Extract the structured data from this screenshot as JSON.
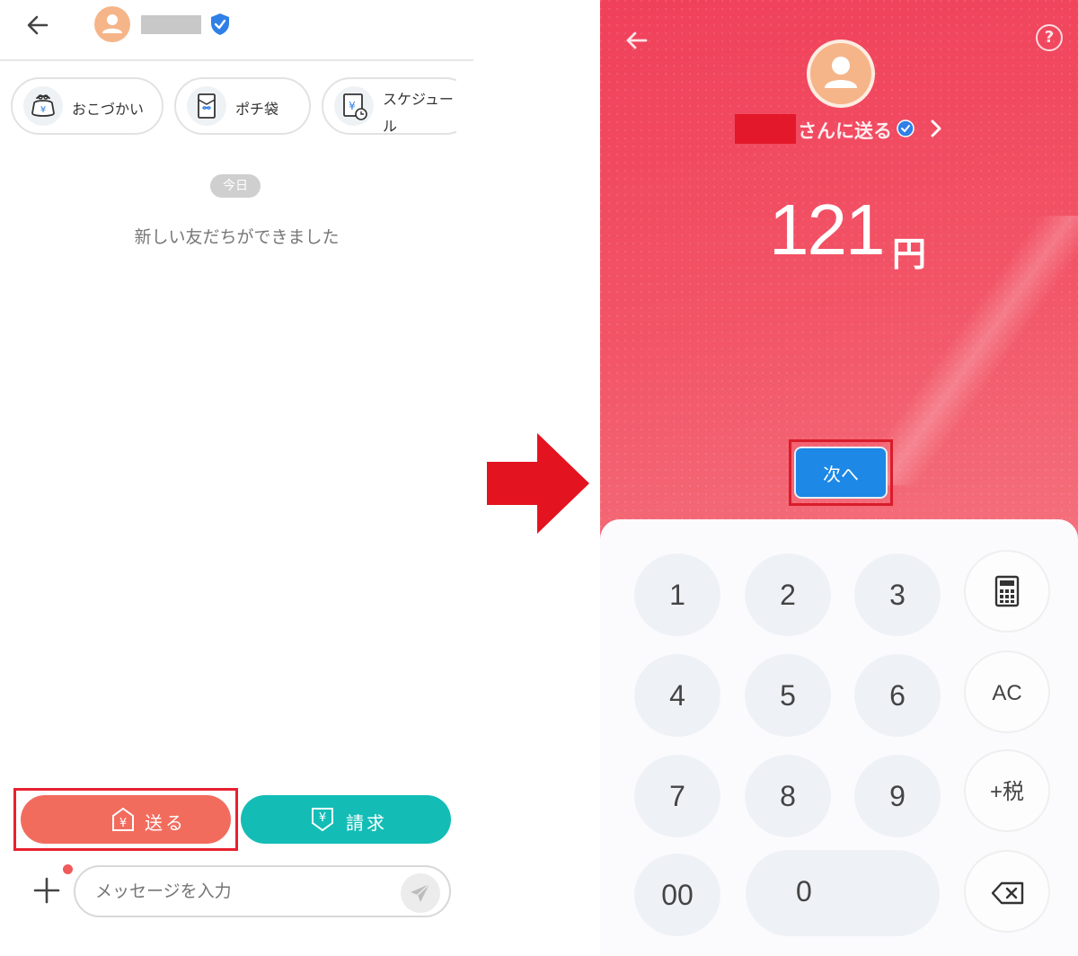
{
  "left": {
    "chips": [
      {
        "label": "おこづかい"
      },
      {
        "label": "ポチ袋"
      },
      {
        "label": "スケジュール"
      }
    ],
    "date_label": "今日",
    "system_message": "新しい友だちができました",
    "send_button": "送る",
    "request_button": "請求",
    "message_placeholder": "メッセージを入力"
  },
  "right": {
    "recipient_suffix": "さんに送る",
    "amount": "121",
    "currency": "円",
    "next_button": "次へ",
    "keys": [
      "1",
      "2",
      "3",
      "4",
      "5",
      "6",
      "7",
      "8",
      "9",
      "00",
      "0"
    ],
    "side_keys": {
      "clear": "AC",
      "tax": "+税"
    }
  },
  "colors": {
    "send_button": "#f26c5e",
    "request_button": "#13bdb6",
    "right_background": "#f04c5c",
    "next_button": "#1d88e5",
    "highlight": "#e8212f"
  }
}
